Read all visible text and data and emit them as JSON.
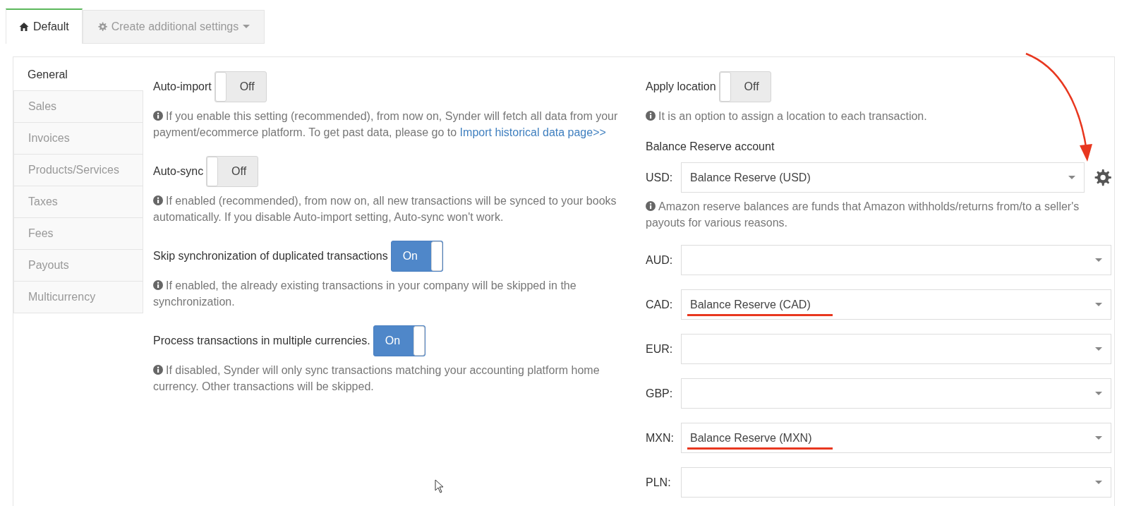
{
  "tabs": [
    {
      "label": "Default",
      "kind": "page",
      "selected": true
    },
    {
      "label": "Create additional settings",
      "kind": "dropdown",
      "selected": false
    }
  ],
  "sidebar": {
    "items": [
      {
        "label": "General",
        "selected": true
      },
      {
        "label": "Sales",
        "selected": false
      },
      {
        "label": "Invoices",
        "selected": false
      },
      {
        "label": "Products/Services",
        "selected": false
      },
      {
        "label": "Taxes",
        "selected": false
      },
      {
        "label": "Fees",
        "selected": false
      },
      {
        "label": "Payouts",
        "selected": false
      },
      {
        "label": "Multicurrency",
        "selected": false
      }
    ]
  },
  "settings": [
    {
      "label": "Auto-import",
      "toggle": "Off",
      "on": false,
      "info": "If you enable this setting (recommended), from now on, Synder will fetch all data from your payment/ecommerce platform. To get past data, please go to",
      "link": "Import historical data page>>"
    },
    {
      "label": "Auto-sync",
      "toggle": "Off",
      "on": false,
      "info": "If enabled (recommended), from now on, all new transactions will be synced to your books automatically. If you disable Auto-import setting, Auto-sync won't work."
    },
    {
      "label": "Skip synchronization of duplicated transactions",
      "toggle": "On",
      "on": true,
      "info": "If enabled, the already existing transactions in your company will be skipped in the synchronization."
    },
    {
      "label": "Process transactions in multiple currencies.",
      "toggle": "On",
      "on": true,
      "info": "If disabled, Synder will only sync transactions matching your accounting platform home currency. Other transactions will be skipped."
    }
  ],
  "location": {
    "label": "Apply location",
    "toggle": "Off",
    "on": false,
    "info": "It is an option to assign a location to each transaction."
  },
  "balance_reserve": {
    "title": "Balance Reserve account",
    "info": "Amazon reserve balances are funds that Amazon withholds/returns from/to a seller's payouts for various reasons.",
    "accounts": [
      {
        "currency": "USD:",
        "value": "Balance Reserve (USD)",
        "underlined": false
      },
      {
        "currency": "AUD:",
        "underlined": false
      },
      {
        "currency": "CAD:",
        "value": "Balance Reserve (CAD)",
        "underlined": true
      },
      {
        "currency": "EUR:",
        "underlined": false
      },
      {
        "currency": "GBP:",
        "underlined": false
      },
      {
        "currency": "MXN:",
        "value": "Balance Reserve (MXN)",
        "underlined": true
      },
      {
        "currency": "PLN:",
        "underlined": false
      }
    ]
  }
}
